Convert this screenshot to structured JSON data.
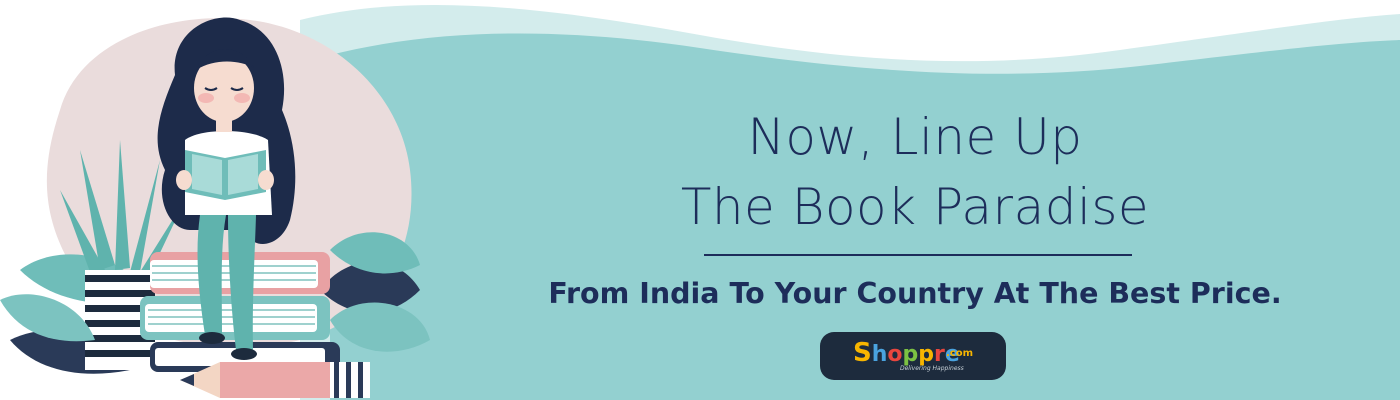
{
  "headline": {
    "line1": "Now, Line Up",
    "line2": "The Book Paradise"
  },
  "subheadline": "From India To Your Country At The Best Price.",
  "logo": {
    "letters": [
      "S",
      "h",
      "o",
      "p",
      "p",
      "r",
      "e"
    ],
    "domain": ".com",
    "tagline": "Delivering Happiness"
  },
  "colors": {
    "teal": "#93d0d0",
    "navy_text": "#1d2d5a",
    "logo_bg": "#1d2b3d"
  },
  "illustration": {
    "subject": "girl reading a book sitting on a stack of books with plants and a pencil"
  }
}
